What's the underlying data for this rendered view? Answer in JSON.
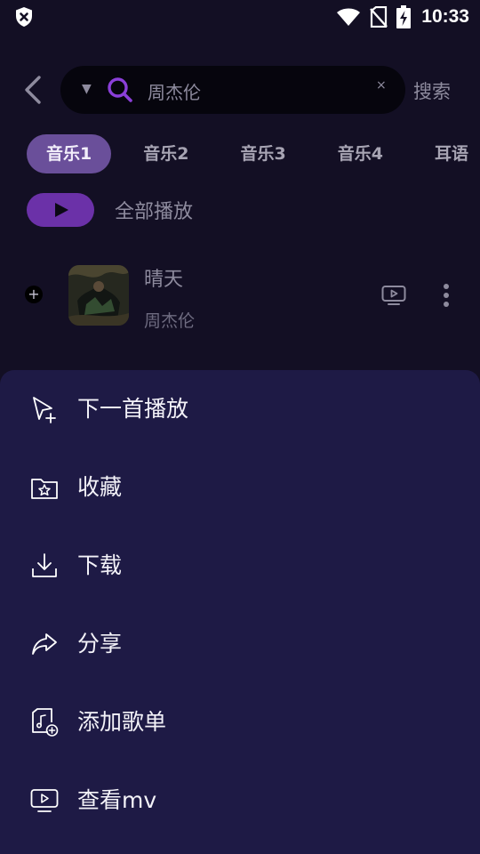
{
  "status_bar": {
    "time": "10:33",
    "icons": [
      "shield-x-icon",
      "wifi-icon",
      "no-sim-icon",
      "battery-charging-icon"
    ]
  },
  "search": {
    "back_icon": "chevron-left-icon",
    "dropdown_icon": "triangle-down-icon",
    "search_icon": "search-icon",
    "query": "周杰伦",
    "clear_icon": "close-icon",
    "clear_glyph": "×",
    "submit_label": "搜索"
  },
  "tabs": [
    {
      "label": "音乐1",
      "active": true
    },
    {
      "label": "音乐2",
      "active": false
    },
    {
      "label": "音乐3",
      "active": false
    },
    {
      "label": "音乐4",
      "active": false
    },
    {
      "label": "耳语",
      "active": false
    }
  ],
  "play_all": {
    "icon": "play-icon",
    "label": "全部播放"
  },
  "songs": [
    {
      "title": "晴天",
      "artist": "周杰伦",
      "add_icon": "plus-icon",
      "mv_icon": "mv-tv-icon",
      "more_icon": "more-vertical-icon"
    }
  ],
  "action_sheet": {
    "items": [
      {
        "icon": "cursor-plus-icon",
        "label": "下一首播放"
      },
      {
        "icon": "folder-star-icon",
        "label": "收藏"
      },
      {
        "icon": "download-icon",
        "label": "下载"
      },
      {
        "icon": "share-arrow-icon",
        "label": "分享"
      },
      {
        "icon": "music-file-plus-icon",
        "label": "添加歌单"
      },
      {
        "icon": "tv-play-icon",
        "label": "查看mv"
      }
    ]
  },
  "colors": {
    "background": "#130f24",
    "sheet": "#1e1a45",
    "accent_purple": "#6b31a8",
    "active_tab": "#6a4f9a",
    "search_icon": "#8b3fd9",
    "muted_text": "#8e8b9e"
  }
}
